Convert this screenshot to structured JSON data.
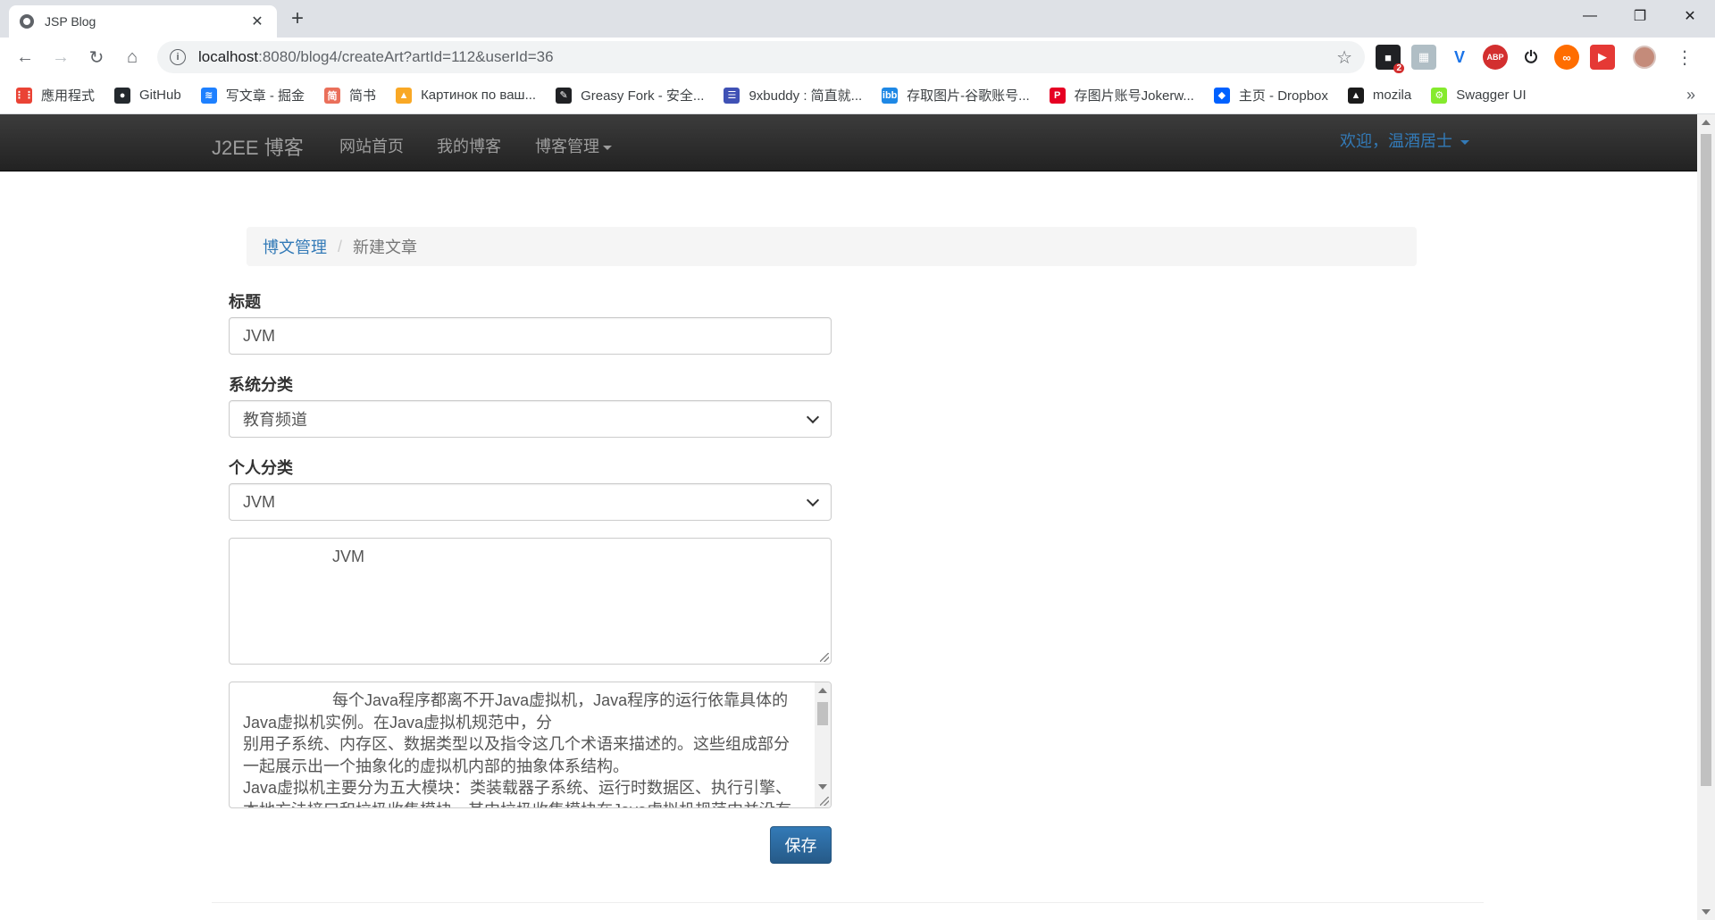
{
  "browser": {
    "tab_title": "JSP Blog",
    "tab_close": "✕",
    "new_tab": "+",
    "url_host": "localhost",
    "url_path": ":8080/blog4/createArt?artId=112&userId=36",
    "extension_badge": "2",
    "bookmarks": [
      {
        "label": "應用程式",
        "icon": "apps-grid-icon",
        "color": "#ea4335"
      },
      {
        "label": "GitHub",
        "icon": "github-icon",
        "color": "#24292e"
      },
      {
        "label": "写文章 - 掘金",
        "icon": "juejin-icon",
        "color": "#1e80ff"
      },
      {
        "label": "简书",
        "icon": "jianshu-icon",
        "color": "#ea6f5a"
      },
      {
        "label": "Картинок по ваш...",
        "icon": "image-icon",
        "color": "#f9a825"
      },
      {
        "label": "Greasy Fork - 安全...",
        "icon": "greasyfork-icon",
        "color": "#202124"
      },
      {
        "label": "9xbuddy : 简直就...",
        "icon": "9xbuddy-icon",
        "color": "#3f51b5"
      },
      {
        "label": "存取图片-谷歌账号...",
        "icon": "ibb-icon",
        "color": "#1e88e5"
      },
      {
        "label": "存图片账号Jokerw...",
        "icon": "pinterest-icon",
        "color": "#e60023"
      },
      {
        "label": "主页 - Dropbox",
        "icon": "dropbox-icon",
        "color": "#0061ff"
      },
      {
        "label": "mozila",
        "icon": "mdn-icon",
        "color": "#1b1b1b"
      },
      {
        "label": "Swagger UI",
        "icon": "swagger-icon",
        "color": "#85ea2d"
      }
    ]
  },
  "navbar": {
    "brand": "J2EE 博客",
    "links": [
      "网站首页",
      "我的博客",
      "博客管理"
    ],
    "welcome": "欢迎，温酒居士"
  },
  "breadcrumb": {
    "parent": "博文管理",
    "separator": "/",
    "current": "新建文章"
  },
  "form": {
    "title_label": "标题",
    "title_value": "JVM",
    "system_category_label": "系统分类",
    "system_category_value": "教育频道",
    "personal_category_label": "个人分类",
    "personal_category_value": "JVM",
    "summary_value": "                    JVM",
    "content_value": "                    每个Java程序都离不开Java虚拟机，Java程序的运行依靠具体的Java虚拟机实例。在Java虚拟机规范中，分\n别用子系统、内存区、数据类型以及指令这几个术语来描述的。这些组成部分一起展示出一个抽象化的虚拟机内部的抽象体系结构。\nJava虚拟机主要分为五大模块：类装载器子系统、运行时数据区、执行引擎、本地方法接口和垃圾收集模块。其中垃圾收集模块在Java虚拟机规范中并没有",
    "save_label": "保存"
  },
  "colors": {
    "link": "#337ab7",
    "navbar_bg": "#222222",
    "primary_button": "#337ab7"
  }
}
